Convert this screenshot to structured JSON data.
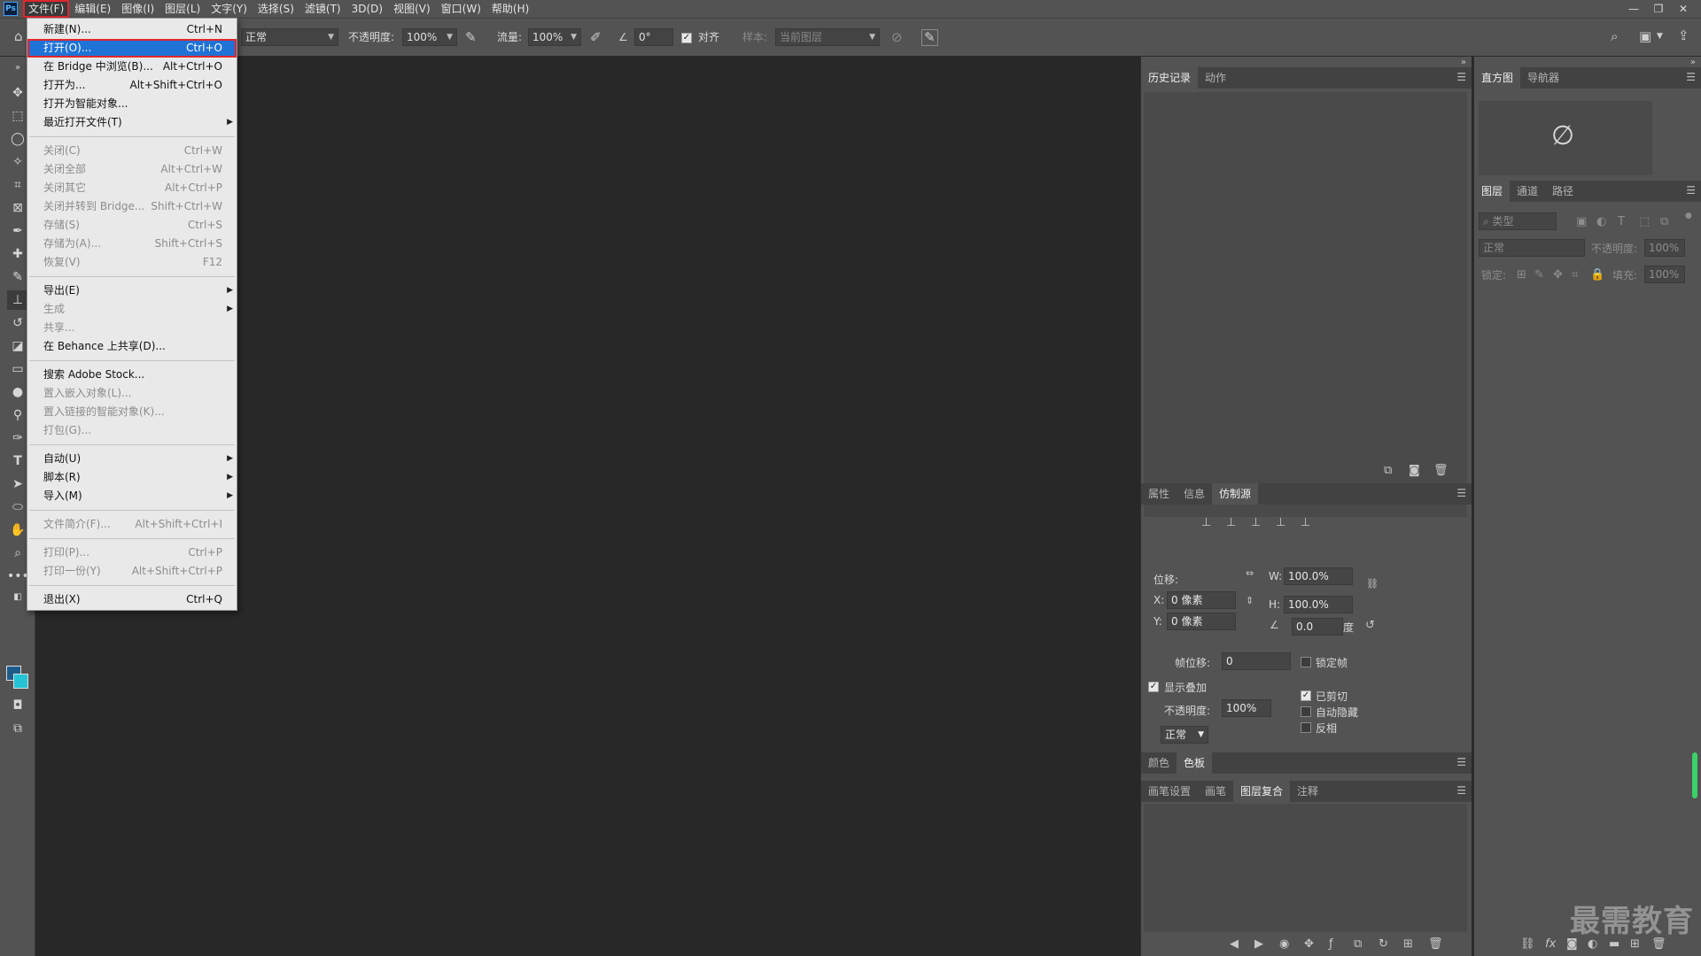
{
  "app": {
    "logo": "Ps"
  },
  "menubar": {
    "items": [
      "文件(F)",
      "编辑(E)",
      "图像(I)",
      "图层(L)",
      "文字(Y)",
      "选择(S)",
      "滤镜(T)",
      "3D(D)",
      "视图(V)",
      "窗口(W)",
      "帮助(H)"
    ],
    "active_index": 0
  },
  "window_controls": {
    "minimize": "—",
    "restore": "❐",
    "close": "✕"
  },
  "options_bar": {
    "mode_value": "正常",
    "opacity_label": "不透明度:",
    "opacity_value": "100%",
    "flow_label": "流量:",
    "flow_value": "100%",
    "angle_value": "0°",
    "align_label": "对齐",
    "sample_label": "样本:",
    "sample_value": "当前图层"
  },
  "file_menu": {
    "items": [
      {
        "label": "新建(N)...",
        "shortcut": "Ctrl+N",
        "enabled": true
      },
      {
        "label": "打开(O)...",
        "shortcut": "Ctrl+O",
        "enabled": true,
        "highlighted": true
      },
      {
        "label": "在 Bridge 中浏览(B)...",
        "shortcut": "Alt+Ctrl+O",
        "enabled": true
      },
      {
        "label": "打开为...",
        "shortcut": "Alt+Shift+Ctrl+O",
        "enabled": true
      },
      {
        "label": "打开为智能对象...",
        "shortcut": "",
        "enabled": true
      },
      {
        "label": "最近打开文件(T)",
        "shortcut": "",
        "enabled": true,
        "submenu": true
      },
      {
        "separator": true
      },
      {
        "label": "关闭(C)",
        "shortcut": "Ctrl+W",
        "enabled": false
      },
      {
        "label": "关闭全部",
        "shortcut": "Alt+Ctrl+W",
        "enabled": false
      },
      {
        "label": "关闭其它",
        "shortcut": "Alt+Ctrl+P",
        "enabled": false
      },
      {
        "label": "关闭并转到 Bridge...",
        "shortcut": "Shift+Ctrl+W",
        "enabled": false
      },
      {
        "label": "存储(S)",
        "shortcut": "Ctrl+S",
        "enabled": false
      },
      {
        "label": "存储为(A)...",
        "shortcut": "Shift+Ctrl+S",
        "enabled": false
      },
      {
        "label": "恢复(V)",
        "shortcut": "F12",
        "enabled": false
      },
      {
        "separator": true
      },
      {
        "label": "导出(E)",
        "shortcut": "",
        "enabled": true,
        "submenu": true
      },
      {
        "label": "生成",
        "shortcut": "",
        "enabled": false,
        "submenu": true
      },
      {
        "label": "共享...",
        "shortcut": "",
        "enabled": false
      },
      {
        "label": "在 Behance 上共享(D)...",
        "shortcut": "",
        "enabled": true
      },
      {
        "separator": true
      },
      {
        "label": "搜索 Adobe Stock...",
        "shortcut": "",
        "enabled": true
      },
      {
        "label": "置入嵌入对象(L)...",
        "shortcut": "",
        "enabled": false
      },
      {
        "label": "置入链接的智能对象(K)...",
        "shortcut": "",
        "enabled": false
      },
      {
        "label": "打包(G)...",
        "shortcut": "",
        "enabled": false
      },
      {
        "separator": true
      },
      {
        "label": "自动(U)",
        "shortcut": "",
        "enabled": true,
        "submenu": true
      },
      {
        "label": "脚本(R)",
        "shortcut": "",
        "enabled": true,
        "submenu": true
      },
      {
        "label": "导入(M)",
        "shortcut": "",
        "enabled": true,
        "submenu": true
      },
      {
        "separator": true
      },
      {
        "label": "文件简介(F)...",
        "shortcut": "Alt+Shift+Ctrl+I",
        "enabled": false
      },
      {
        "separator": true
      },
      {
        "label": "打印(P)...",
        "shortcut": "Ctrl+P",
        "enabled": false
      },
      {
        "label": "打印一份(Y)",
        "shortcut": "Alt+Shift+Ctrl+P",
        "enabled": false
      },
      {
        "separator": true
      },
      {
        "label": "退出(X)",
        "shortcut": "Ctrl+Q",
        "enabled": true
      }
    ]
  },
  "history_panel": {
    "tabs": [
      "历史记录",
      "动作"
    ],
    "active": 0
  },
  "properties_panel": {
    "tabs": [
      "属性",
      "信息",
      "仿制源"
    ],
    "active": 2,
    "offset_label": "位移:",
    "w_label": "W:",
    "w_value": "100.0%",
    "h_label": "H:",
    "h_value": "100.0%",
    "x_label": "X:",
    "x_value": "0 像素",
    "y_label": "Y:",
    "y_value": "0 像素",
    "angle_value": "0.0",
    "degree_label": "度",
    "frame_offset_label": "帧位移:",
    "frame_offset_value": "0",
    "lock_frame_label": "锁定帧",
    "show_overlay_label": "显示叠加",
    "opacity_label": "不透明度:",
    "opacity_value": "100%",
    "clipped_label": "已剪切",
    "auto_hide_label": "自动隐藏",
    "invert_label": "反相",
    "blend_value": "正常"
  },
  "color_panel": {
    "tabs": [
      "颜色",
      "色板"
    ],
    "active": 1
  },
  "brush_panel": {
    "tabs": [
      "画笔设置",
      "画笔",
      "图层复合",
      "注释"
    ],
    "active": 2
  },
  "histogram_panel": {
    "tabs": [
      "直方图",
      "导航器"
    ],
    "active": 0,
    "empty_symbol": "∅"
  },
  "layers_panel": {
    "tabs": [
      "图层",
      "通道",
      "路径"
    ],
    "active": 0,
    "filter_placeholder": "类型",
    "blend_value": "正常",
    "opacity_label": "不透明度:",
    "opacity_value": "100%",
    "lock_label": "锁定:",
    "fill_label": "填充:",
    "fill_value": "100%"
  },
  "watermark": "最需教育"
}
